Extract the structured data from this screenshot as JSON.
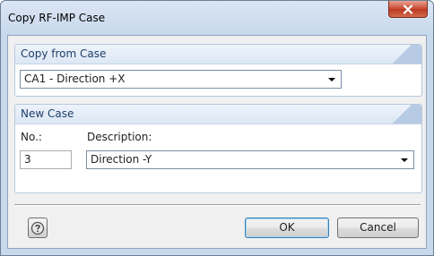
{
  "window": {
    "title": "Copy RF-IMP Case"
  },
  "copy_from": {
    "header": "Copy from Case",
    "selected": "CA1 - Direction +X"
  },
  "new_case": {
    "header": "New Case",
    "no_label": "No.:",
    "no_value": "3",
    "description_label": "Description:",
    "description_value": "Direction -Y"
  },
  "buttons": {
    "ok": "OK",
    "cancel": "Cancel"
  },
  "icons": {
    "close": "close-icon",
    "help": "help-icon"
  },
  "colors": {
    "close_button": "#c9492f",
    "accent": "#1f3f6b"
  }
}
